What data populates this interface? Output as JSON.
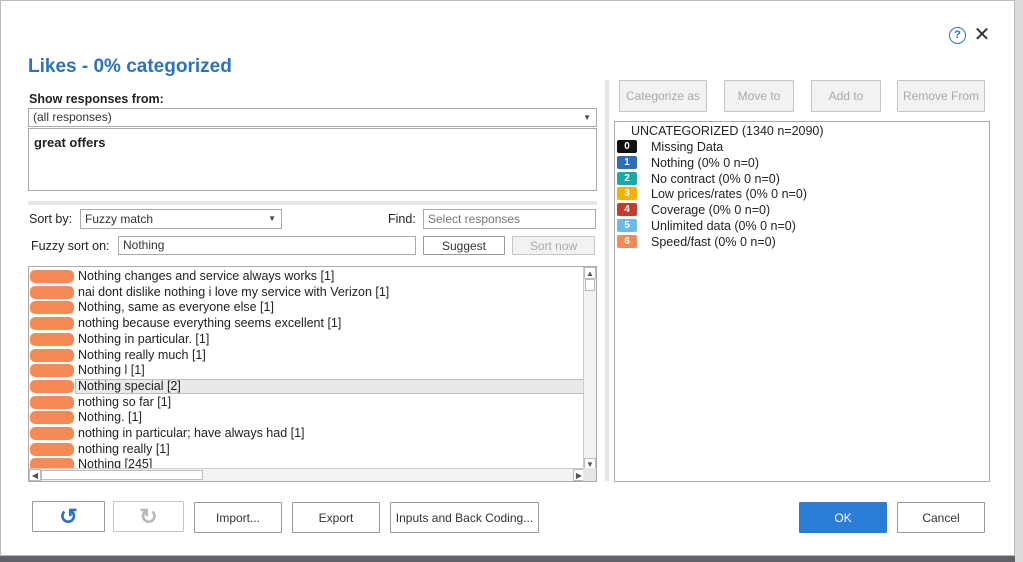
{
  "dialog": {
    "title": "Likes - 0% categorized",
    "help_symbol": "?",
    "close_symbol": "✕"
  },
  "filter": {
    "show_label": "Show responses from:",
    "show_value": "(all responses)",
    "query_text": "great offers"
  },
  "sort": {
    "sort_by_label": "Sort by:",
    "sort_by_value": "Fuzzy match",
    "find_label": "Find:",
    "find_placeholder": "Select responses",
    "fuzzy_label": "Fuzzy sort on:",
    "fuzzy_value": "Nothing",
    "suggest_label": "Suggest",
    "sort_now_label": "Sort now"
  },
  "responses": [
    "Nothing changes and service always works [1]",
    "nai dont dislike nothing i love my service with Verizon [1]",
    "Nothing, same as everyone else [1]",
    "nothing because everything seems excellent [1]",
    "Nothing in particular. [1]",
    "Nothing really much [1]",
    "Nothing l [1]",
    "Nothing special [2]",
    "nothing so far [1]",
    "Nothing. [1]",
    "nothing in particular; have always had [1]",
    "nothing really [1]",
    "Nothing [245]"
  ],
  "selected_response_index": 7,
  "action_buttons": {
    "categorize": "Categorize as",
    "move": "Move to",
    "add": "Add to",
    "remove": "Remove From"
  },
  "categories": {
    "uncategorized": "UNCATEGORIZED (1340 n=2090)",
    "items": [
      {
        "num": "0",
        "label": "Missing Data",
        "color": "#111111"
      },
      {
        "num": "1",
        "label": "Nothing (0% 0 n=0)",
        "color": "#2f6db5"
      },
      {
        "num": "2",
        "label": "No contract (0% 0 n=0)",
        "color": "#1aa9a8"
      },
      {
        "num": "3",
        "label": "Low prices/rates (0% 0 n=0)",
        "color": "#f2b400"
      },
      {
        "num": "4",
        "label": "Coverage (0% 0 n=0)",
        "color": "#c43c2e"
      },
      {
        "num": "5",
        "label": "Unlimited data (0% 0 n=0)",
        "color": "#6cb9ee"
      },
      {
        "num": "6",
        "label": "Speed/fast (0% 0 n=0)",
        "color": "#f58a57"
      }
    ]
  },
  "footer": {
    "undo_symbol": "↺",
    "redo_symbol": "↻",
    "import": "Import...",
    "export": "Export",
    "inputs": "Inputs and Back Coding...",
    "ok": "OK",
    "cancel": "Cancel"
  },
  "colors": {
    "accent": "#2a72c4",
    "primary_button": "#2a7ed8",
    "response_pill": "#f58a57"
  }
}
